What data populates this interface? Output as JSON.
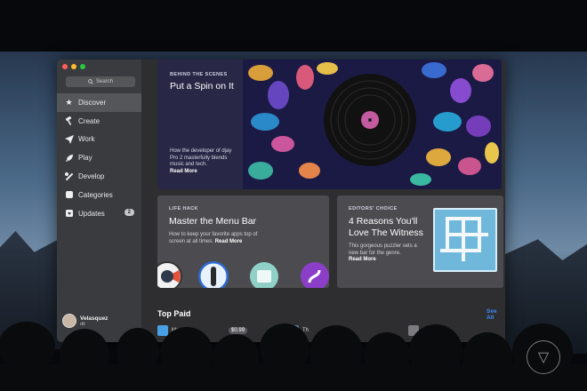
{
  "sidebar": {
    "search_label": "Search",
    "items": [
      {
        "label": "Discover",
        "icon": "star-icon"
      },
      {
        "label": "Create",
        "icon": "hammer-icon"
      },
      {
        "label": "Work",
        "icon": "paper-plane-icon"
      },
      {
        "label": "Play",
        "icon": "rocket-icon"
      },
      {
        "label": "Develop",
        "icon": "wrench-icon"
      },
      {
        "label": "Categories",
        "icon": "categories-icon"
      },
      {
        "label": "Updates",
        "icon": "download-icon",
        "badge": "2"
      }
    ],
    "user": {
      "name": "Velasquez",
      "sub": "dit"
    }
  },
  "hero": {
    "eyebrow": "BEHIND THE SCENES",
    "title": "Put a Spin on It",
    "description": "How the developer of djay Pro 2 masterfully blends music and tech.",
    "read_more": "Read More"
  },
  "card1": {
    "eyebrow": "LIFE HACK",
    "title": "Master the Menu Bar",
    "description": "How to keep your favorite apps top of screen at all times.",
    "read_more": "Read More"
  },
  "card2": {
    "eyebrow": "EDITORS' CHOICE",
    "title_line1": "4 Reasons You'll",
    "title_line2": "Love The Witness",
    "description": "This gorgeous puzzler sets a new bar for the genre.",
    "read_more": "Read More"
  },
  "top_paid": {
    "title": "Top Paid",
    "see_all": "See All",
    "rows": [
      {
        "name": "Magnet",
        "price": "$0.99"
      },
      {
        "name": "Th"
      },
      {
        "name": "M"
      }
    ]
  },
  "colors": {
    "accent_link": "#3d8bf2",
    "sidebar_bg": "#3a3b3f",
    "sidebar_active": "#55565a",
    "window_bg": "#2e2e30",
    "hero_bg": "#1a1a3d",
    "card_bg": "#4c4c50",
    "witness_blue": "#6fb8dc"
  }
}
